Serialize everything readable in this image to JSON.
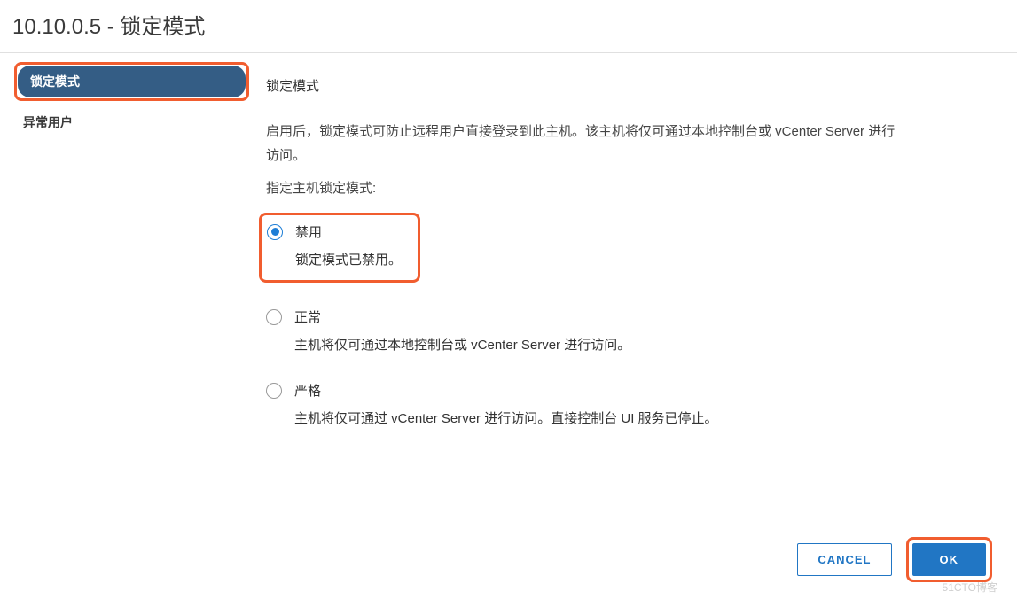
{
  "title": "10.10.0.5 - 锁定模式",
  "sidebar": {
    "items": [
      {
        "label": "锁定模式",
        "active": true
      },
      {
        "label": "异常用户",
        "active": false
      }
    ]
  },
  "main": {
    "section_title": "锁定模式",
    "description": "启用后，锁定模式可防止远程用户直接登录到此主机。该主机将仅可通过本地控制台或 vCenter Server 进行访问。",
    "sub_label": "指定主机锁定模式:",
    "options": [
      {
        "label": "禁用",
        "desc": "锁定模式已禁用。",
        "selected": true,
        "highlighted": true
      },
      {
        "label": "正常",
        "desc": "主机将仅可通过本地控制台或 vCenter Server 进行访问。",
        "selected": false,
        "highlighted": false
      },
      {
        "label": "严格",
        "desc": "主机将仅可通过 vCenter Server 进行访问。直接控制台 UI 服务已停止。",
        "selected": false,
        "highlighted": false
      }
    ]
  },
  "footer": {
    "cancel": "CANCEL",
    "ok": "OK"
  },
  "watermark": "51CTO博客"
}
